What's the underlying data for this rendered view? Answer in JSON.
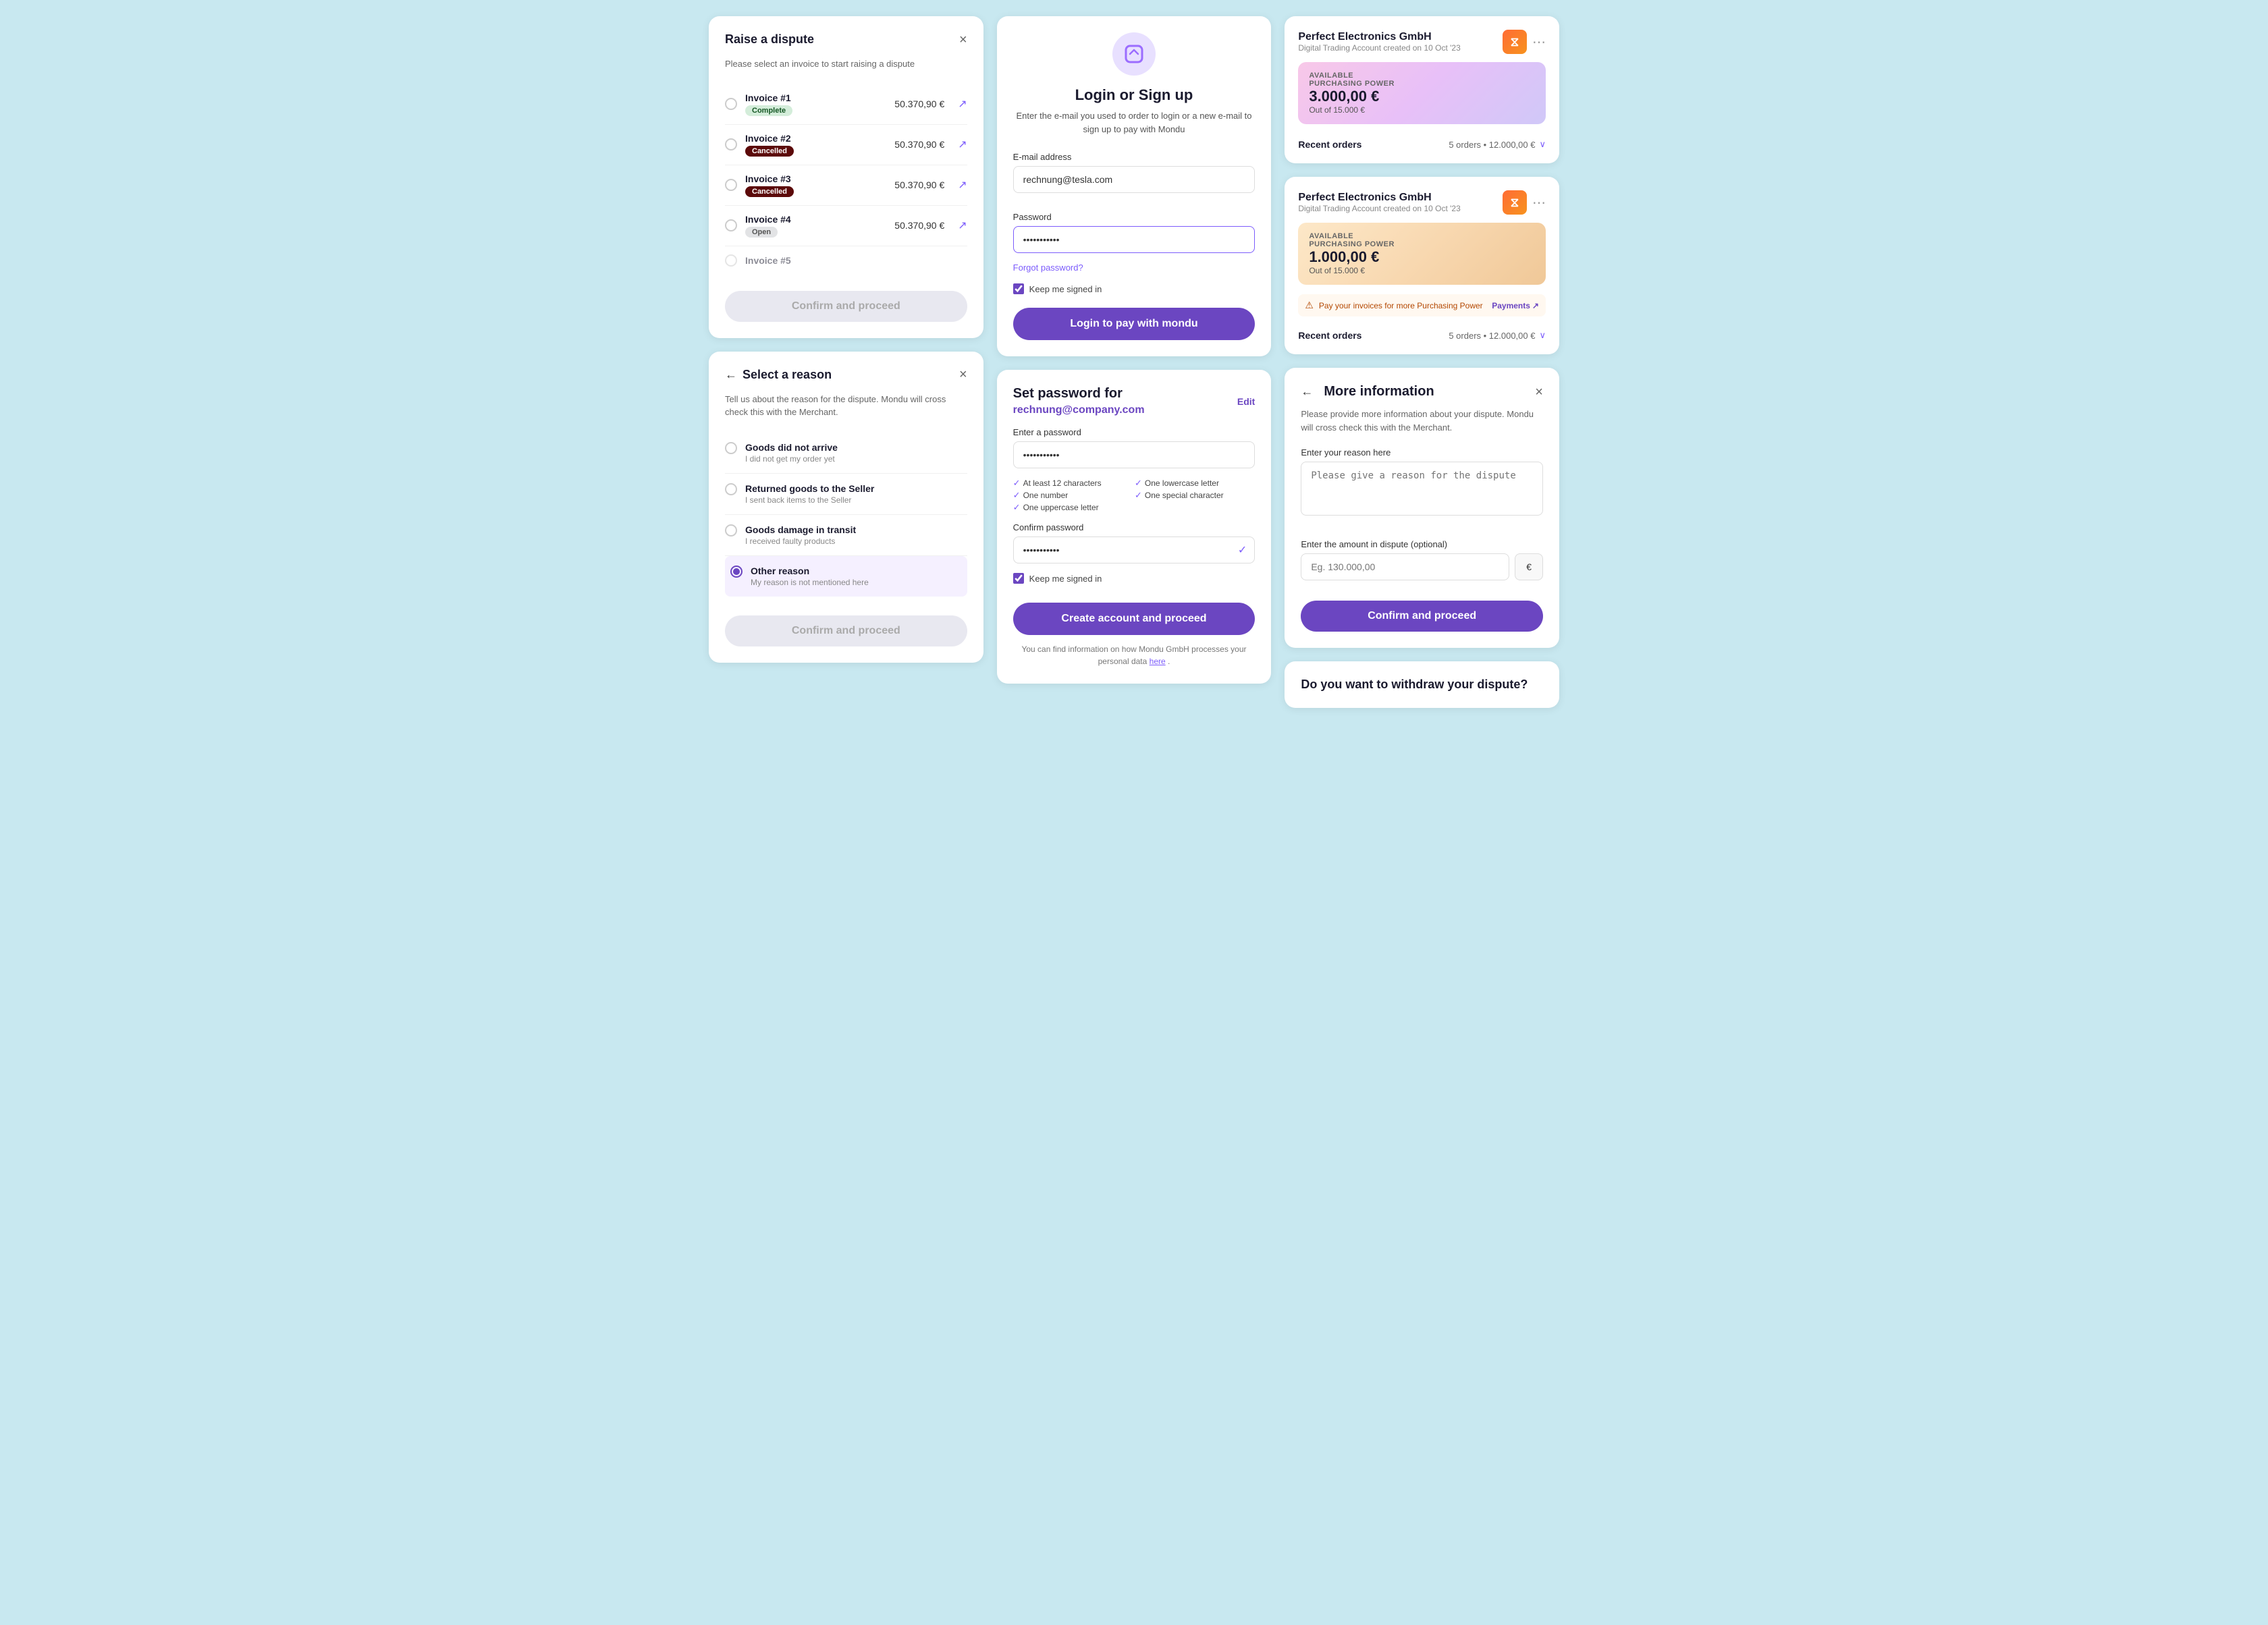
{
  "col1": {
    "dispute": {
      "title": "Raise a dispute",
      "subtitle": "Please select an invoice to start raising a dispute",
      "invoices": [
        {
          "id": "inv1",
          "name": "Invoice #1",
          "amount": "50.370,90 €",
          "status": "Complete",
          "badge": "complete"
        },
        {
          "id": "inv2",
          "name": "Invoice #2",
          "amount": "50.370,90 €",
          "status": "Cancelled",
          "badge": "cancelled"
        },
        {
          "id": "inv3",
          "name": "Invoice #3",
          "amount": "50.370,90 €",
          "status": "Cancelled",
          "badge": "cancelled"
        },
        {
          "id": "inv4",
          "name": "Invoice #4",
          "amount": "50.370,90 €",
          "status": "Open",
          "badge": "open"
        },
        {
          "id": "inv5",
          "name": "Invoice #5",
          "amount": "",
          "status": "",
          "badge": ""
        }
      ],
      "confirm_btn": "Confirm and proceed"
    },
    "reason": {
      "title": "Select a reason",
      "subtitle": "Tell us about the reason for the dispute. Mondu will cross check this with the Merchant.",
      "reasons": [
        {
          "id": "r1",
          "text": "Goods did not arrive",
          "sub": "I did not get my order yet"
        },
        {
          "id": "r2",
          "text": "Returned goods to the Seller",
          "sub": "I sent back items to the Seller"
        },
        {
          "id": "r3",
          "text": "Goods damage in transit",
          "sub": "I received faulty products"
        },
        {
          "id": "r4",
          "text": "Other reason",
          "sub": "My reason is not mentioned here",
          "selected": true
        }
      ],
      "confirm_btn": "Confirm and proceed"
    }
  },
  "col2": {
    "login": {
      "title": "Login or Sign up",
      "subtitle": "Enter the e-mail you used to order to login or a new e-mail to sign up to pay with Mondu",
      "email_label": "E-mail address",
      "email_value": "rechnung@tesla.com",
      "password_label": "Password",
      "password_value": "············",
      "forgot_label": "Forgot password?",
      "remember_label": "Keep me signed in",
      "login_btn": "Login to pay with mondu"
    },
    "set_password": {
      "title": "Set password for",
      "email": "rechnung@company.com",
      "edit_label": "Edit",
      "pw_label": "Enter a password",
      "pw_value": "············",
      "rules": [
        {
          "text": "At least 12 characters"
        },
        {
          "text": "One lowercase letter"
        },
        {
          "text": "One number"
        },
        {
          "text": "One special character"
        },
        {
          "text": "One uppercase letter"
        }
      ],
      "confirm_label": "Confirm password",
      "confirm_value": "············",
      "remember_label": "Keep me signed in",
      "create_btn": "Create account and proceed",
      "privacy_note": "You can find information on how Mondu GmbH processes your personal data ",
      "privacy_link": "here",
      "privacy_suffix": "."
    }
  },
  "col3": {
    "account1": {
      "name": "Perfect Electronics GmbH",
      "sub": "Digital Trading Account created on 10 Oct '23",
      "power_label": "AVAILABLE\nPURCHASING POWER",
      "power_amount": "3.000,00 €",
      "power_out": "Out of 15.000 €",
      "recent_label": "Recent orders",
      "recent_value": "5 orders • 12.000,00 €"
    },
    "account2": {
      "name": "Perfect Electronics GmbH",
      "sub": "Digital Trading Account created on 10 Oct '23",
      "power_label": "AVAILABLE\nPURCHASING POWER",
      "power_amount": "1.000,00 €",
      "power_out": "Out of 15.000 €",
      "warning": "Pay your invoices for more Purchasing Power",
      "payments_label": "Payments",
      "recent_label": "Recent orders",
      "recent_value": "5 orders • 12.000,00 €"
    },
    "more_info": {
      "title": "More information",
      "subtitle": "Please provide more information about your dispute. Mondu will cross check this with the Merchant.",
      "reason_label": "Enter your reason here",
      "reason_placeholder": "Please give a reason for the dispute",
      "amount_label": "Enter the amount in dispute (optional)",
      "amount_placeholder": "Eg. 130.000,00",
      "currency": "€",
      "confirm_btn": "Confirm and proceed"
    },
    "bottom": {
      "title": "Do you want to withdraw your dispute?"
    }
  },
  "icons": {
    "close": "×",
    "back": "←",
    "more": "⋯",
    "chevron_down": "∨",
    "ext_link": "↗",
    "check": "✓",
    "warning": "⚠",
    "ext_small": "↗"
  }
}
